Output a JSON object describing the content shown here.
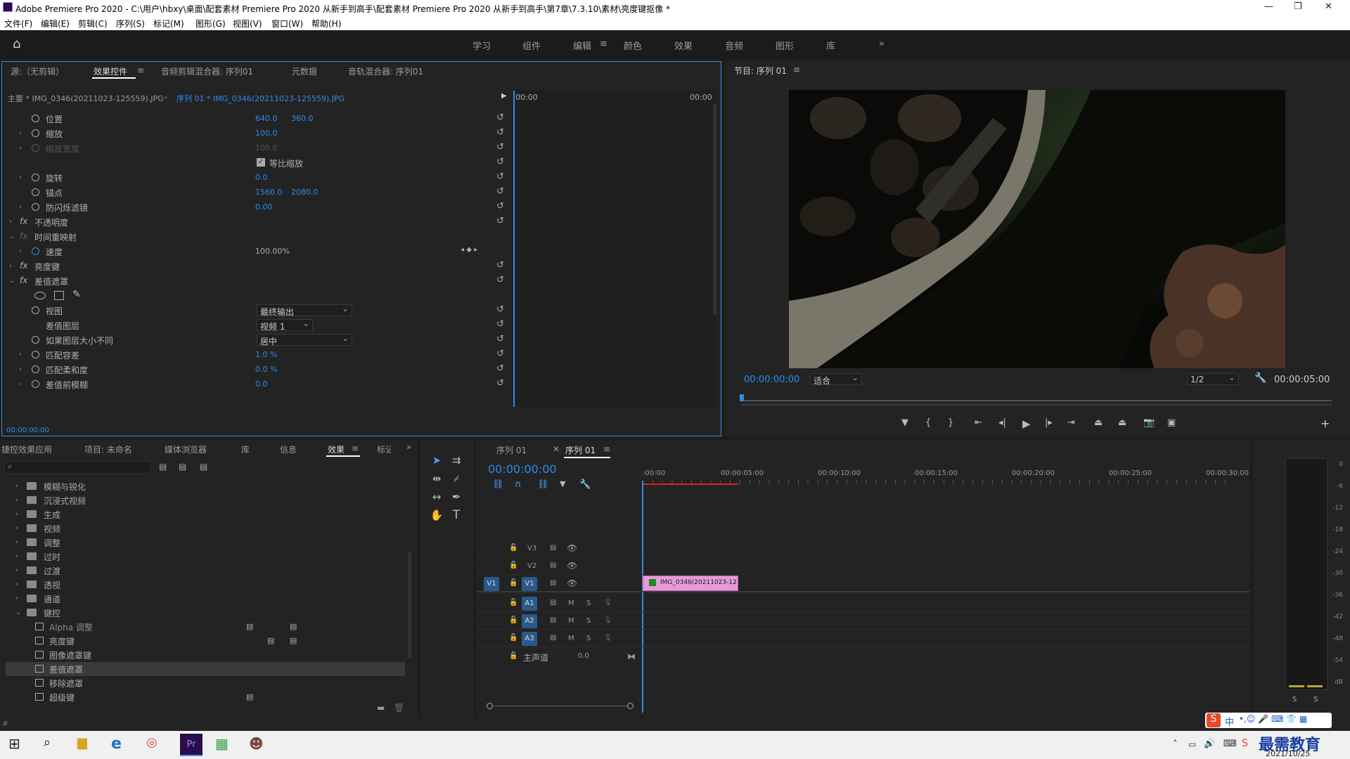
{
  "titlebar": {
    "title": "Adobe Premiere Pro 2020 - C:\\用户\\hbxy\\桌面\\配套素材 Premiere Pro 2020 从新手到高手\\配套素材 Premiere Pro 2020 从新手到高手\\第7章\\7.3.10\\素材\\亮度键抠像 *"
  },
  "menu": [
    "文件(F)",
    "编辑(E)",
    "剪辑(C)",
    "序列(S)",
    "标记(M)",
    "图形(G)",
    "视图(V)",
    "窗口(W)",
    "帮助(H)"
  ],
  "workspaces": [
    "学习",
    "组件",
    "编辑",
    "颜色",
    "效果",
    "音频",
    "图形",
    "库"
  ],
  "workspace_more": "»",
  "effect_panel": {
    "tabs": [
      "源:（无剪辑）",
      "效果控件",
      "音频剪辑混合器: 序列01",
      "元数据",
      "音轨混合器: 序列01"
    ],
    "master_clip": "主要 * IMG_0346(20211023-125559).JPG",
    "seq_clip": "序列 01 * IMG_0346(20211023-125559).JPG",
    "time_start": "00:00",
    "time_end": "00:00",
    "rows": [
      {
        "label": "位置",
        "v1": "640.0",
        "v2": "360.0"
      },
      {
        "label": "缩放",
        "v1": "100.0"
      },
      {
        "label": "缩放宽度",
        "v1": "100.0"
      },
      {
        "label": "等比缩放"
      },
      {
        "label": "旋转",
        "v1": "0.0"
      },
      {
        "label": "锚点",
        "v1": "1560.0",
        "v2": "2080.0"
      },
      {
        "label": "防闪烁滤镜",
        "v1": "0.00"
      },
      {
        "label": "不透明度"
      },
      {
        "label": "时间重映射"
      },
      {
        "label": "速度",
        "v1": "100.00%"
      },
      {
        "label": "亮度键"
      },
      {
        "label": "差值遮罩"
      },
      {
        "label": "视图",
        "dd": "最终输出"
      },
      {
        "label": "差值图层",
        "dd": "视频 1"
      },
      {
        "label": "如果图层大小不同",
        "dd": "居中"
      },
      {
        "label": "匹配容差",
        "v1": "1.0 %"
      },
      {
        "label": "匹配柔和度",
        "v1": "0.0 %"
      },
      {
        "label": "差值前模糊",
        "v1": "0.0"
      }
    ],
    "timecode": "00:00:00:00"
  },
  "program": {
    "title": "节目: 序列 01",
    "timecode": "00:00:00:00",
    "fit": "适合",
    "res": "1/2",
    "duration": "00:00:05:00"
  },
  "project": {
    "tabs": [
      "捷控效果应用",
      "项目: 未命名",
      "媒体浏览器",
      "库",
      "信息",
      "效果",
      "标记"
    ],
    "folders": [
      "模糊与锐化",
      "沉浸式视频",
      "生成",
      "视频",
      "调整",
      "过时",
      "过渡",
      "透视",
      "通道",
      "键控"
    ],
    "items": [
      "Alpha 调整",
      "亮度键",
      "图像遮罩键",
      "差值遮罩",
      "移除遮罩",
      "超级键"
    ]
  },
  "timeline": {
    "tabs": [
      "序列 01",
      "序列 01"
    ],
    "timecode": "00:00:00:00",
    "ruler": [
      ":00:00",
      "00:00:05:00",
      "00:00:10:00",
      "00:00:15:00",
      "00:00:20:00",
      "00:00:25:00",
      "00:00:30:00"
    ],
    "video_tracks": [
      "V3",
      "V2",
      "V1"
    ],
    "audio_tracks": [
      "A1",
      "A2",
      "A3"
    ],
    "src_v": "V1",
    "mix_label": "主声道",
    "mix_value": "0.0",
    "clip": "IMG_0346(20211023-12"
  },
  "meter": {
    "labels": [
      "0",
      "-6",
      "-12",
      "-18",
      "-24",
      "-30",
      "-36",
      "-42",
      "-48",
      "-54",
      "dB"
    ],
    "solo": [
      "S",
      "S"
    ]
  },
  "tray": {
    "ime": "中",
    "brand": "最需教育",
    "date": "2021/10/25"
  }
}
